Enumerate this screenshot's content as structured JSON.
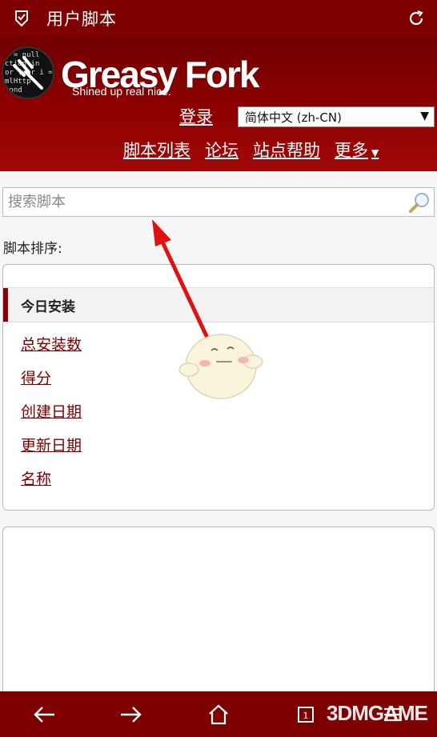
{
  "app": {
    "title": "用户脚本"
  },
  "site": {
    "brand": "Greasy Fork",
    "tagline": "Shined up real nice.",
    "login": "登录",
    "language": "简体中文 (zh-CN)",
    "nav": [
      "脚本列表",
      "论坛",
      "站点帮助",
      "更多"
    ],
    "more_caret": "▼"
  },
  "search": {
    "placeholder": "搜索脚本",
    "value": ""
  },
  "sort": {
    "label": "脚本排序:",
    "active": "今日安装",
    "options": [
      "总安装数",
      "得分",
      "创建日期",
      "更新日期",
      "名称"
    ]
  },
  "watermark": "3DMGAME",
  "icons": {
    "appbar_left": "shield-check-icon",
    "appbar_right": "refresh-icon",
    "search": "magnifier-icon",
    "bottom": [
      "back-arrow-icon",
      "forward-arrow-icon",
      "home-icon",
      "tabs-icon",
      "menu-icon"
    ]
  },
  "colors": {
    "brand_red": "#7f0000",
    "link_red": "#7a0000",
    "annotation_arrow": "#e31010"
  }
}
